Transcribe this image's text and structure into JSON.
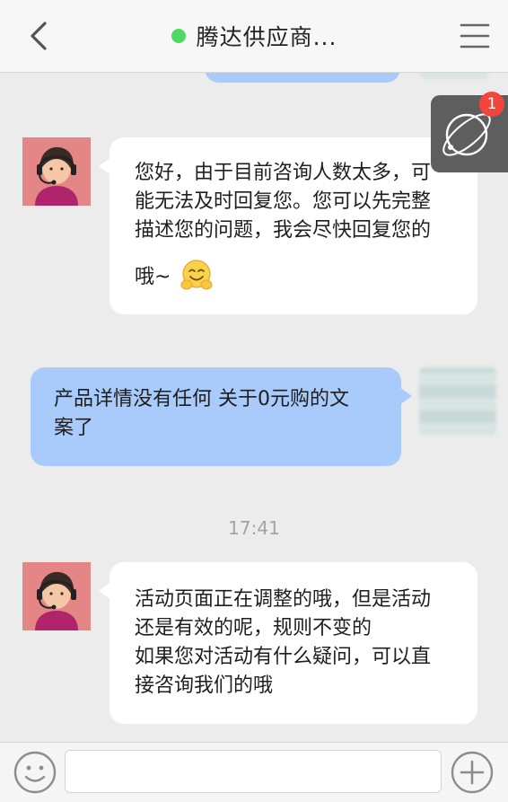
{
  "header": {
    "title": "腾达供应商...",
    "online_color": "#4cd964"
  },
  "float_button": {
    "icon": "browser-globe-icon",
    "badge_count": "1"
  },
  "messages": [
    {
      "sender": "agent",
      "lines": [
        "您好，由于目前咨询人数太多，可",
        "能无法及时回复您。您可以先完整",
        "描述您的问题，我会尽快回复您的",
        "哦~"
      ],
      "emoji": "hugging-face-emoji"
    },
    {
      "sender": "user",
      "lines": [
        "产品详情没有任何 关于0元购的文",
        "案了"
      ]
    },
    {
      "sender": "agent",
      "lines": [
        "活动页面正在调整的哦，但是活动",
        "还是有效的呢，规则不变的",
        "如果您对活动有什么疑问，可以直",
        "接咨询我们的哦"
      ]
    }
  ],
  "timestamp": "17:41",
  "footer": {
    "input_value": "",
    "emoji_icon": "smiley-icon",
    "plus_icon": "plus-circle-icon"
  },
  "colors": {
    "agent_bubble": "#ffffff",
    "user_bubble": "#a8cbfb",
    "badge": "#f2453d",
    "avatar_bg": "#e58686"
  }
}
